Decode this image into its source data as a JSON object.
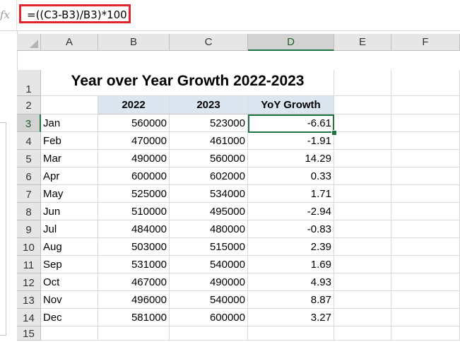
{
  "formula_bar": {
    "fx_label": "fx",
    "formula": "=((C3-B3)/B3)*100"
  },
  "columns": [
    "A",
    "B",
    "C",
    "D",
    "E",
    "F"
  ],
  "rows": [
    "1",
    "2",
    "3",
    "4",
    "5",
    "6",
    "7",
    "8",
    "9",
    "10",
    "11",
    "12",
    "13",
    "14",
    "15"
  ],
  "selected_column": "D",
  "selected_row": "3",
  "sheet": {
    "title": "Year over Year Growth 2022-2023",
    "headers": [
      "2022",
      "2023",
      "YoY Growth"
    ],
    "data": [
      {
        "month": "Jan",
        "y2022": "560000",
        "y2023": "523000",
        "growth": "-6.61"
      },
      {
        "month": "Feb",
        "y2022": "470000",
        "y2023": "461000",
        "growth": "-1.91"
      },
      {
        "month": "Mar",
        "y2022": "490000",
        "y2023": "560000",
        "growth": "14.29"
      },
      {
        "month": "Apr",
        "y2022": "600000",
        "y2023": "602000",
        "growth": "0.33"
      },
      {
        "month": "May",
        "y2022": "525000",
        "y2023": "534000",
        "growth": "1.71"
      },
      {
        "month": "Jun",
        "y2022": "510000",
        "y2023": "495000",
        "growth": "-2.94"
      },
      {
        "month": "Jul",
        "y2022": "484000",
        "y2023": "480000",
        "growth": "-0.83"
      },
      {
        "month": "Aug",
        "y2022": "503000",
        "y2023": "515000",
        "growth": "2.39"
      },
      {
        "month": "Sep",
        "y2022": "531000",
        "y2023": "540000",
        "growth": "1.69"
      },
      {
        "month": "Oct",
        "y2022": "467000",
        "y2023": "490000",
        "growth": "4.93"
      },
      {
        "month": "Nov",
        "y2022": "496000",
        "y2023": "540000",
        "growth": "8.87"
      },
      {
        "month": "Dec",
        "y2022": "581000",
        "y2023": "600000",
        "growth": "3.27"
      }
    ]
  },
  "colors": {
    "formula_highlight": "#e0262c",
    "selection": "#217346",
    "header_fill": "#dce6f1"
  }
}
